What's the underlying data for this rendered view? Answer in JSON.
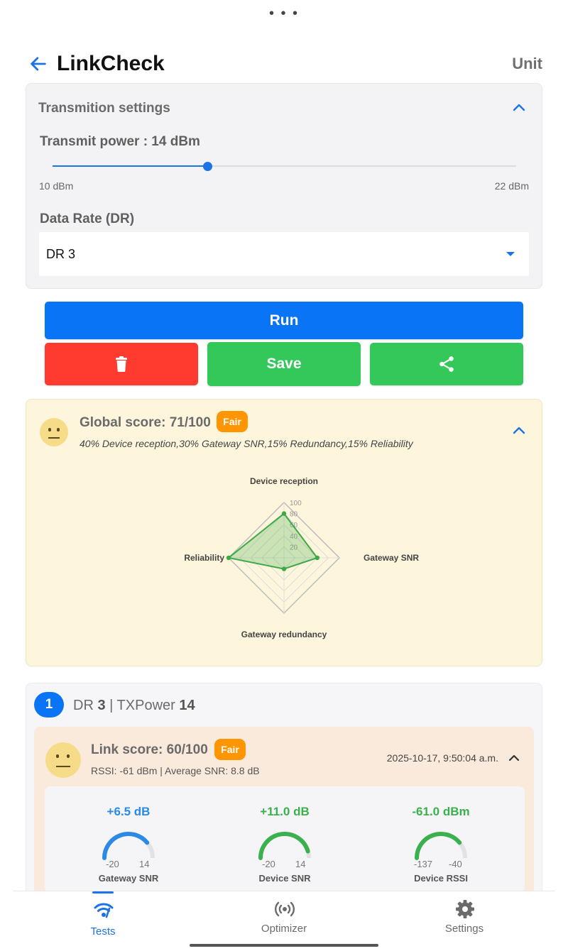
{
  "header": {
    "title": "LinkCheck",
    "unit_label": "Unit"
  },
  "transmission": {
    "title": "Transmition settings",
    "power_label": "Transmit power : 14 dBm",
    "power_value": 14,
    "power_min": 10,
    "power_max": 22,
    "power_min_label": "10 dBm",
    "power_max_label": "22 dBm",
    "dr_label": "Data Rate (DR)",
    "dr_value": "DR 3"
  },
  "actions": {
    "run_label": "Run",
    "save_label": "Save"
  },
  "global_score": {
    "title": "Global score: 71/100",
    "badge": "Fair",
    "weights": "40% Device reception,30% Gateway SNR,15% Redundancy,15% Reliability",
    "radar": {
      "axes": [
        "Device reception",
        "Gateway SNR",
        "Gateway redundancy",
        "Reliability"
      ],
      "values": [
        80,
        60,
        20,
        100
      ],
      "ticks": [
        "20",
        "40",
        "60",
        "80",
        "100"
      ],
      "max": 100
    }
  },
  "test": {
    "index": "1",
    "dr_prefix": "DR",
    "dr": "3",
    "tx_prefix": "TXPower",
    "tx": "14",
    "link_title": "Link score: 60/100",
    "link_badge": "Fair",
    "rssi_line": "RSSI: -61 dBm | Average SNR: 8.8 dB",
    "timestamp": "2025-10-17, 9:50:04 a.m.",
    "metrics": [
      {
        "value": "+6.5 dB",
        "min": "-20",
        "max": "14",
        "label": "Gateway SNR",
        "color": "#2a8ae6",
        "fraction": 0.78
      },
      {
        "value": "+11.0 dB",
        "min": "-20",
        "max": "14",
        "label": "Device SNR",
        "color": "#3bb04f",
        "fraction": 0.91
      },
      {
        "value": "-61.0 dBm",
        "min": "-137",
        "max": "-40",
        "label": "Device RSSI",
        "color": "#3bb04f",
        "fraction": 0.78
      }
    ]
  },
  "nav": {
    "tests": "Tests",
    "optimizer": "Optimizer",
    "settings": "Settings"
  },
  "colors": {
    "primary": "#0a74f7",
    "danger": "#ff3b30",
    "success": "#34c759",
    "warning": "#ff9500"
  }
}
